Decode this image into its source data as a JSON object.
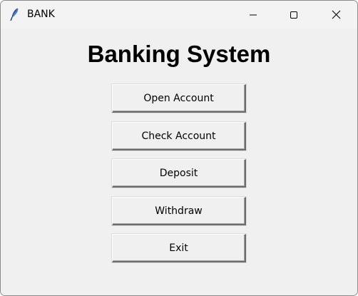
{
  "window": {
    "title": "BANK",
    "icon": "feather-icon"
  },
  "controls": {
    "minimize_icon": "minimize-icon",
    "maximize_icon": "maximize-icon",
    "close_icon": "close-icon"
  },
  "main": {
    "heading": "Banking System",
    "buttons": [
      {
        "label": "Open Account"
      },
      {
        "label": "Check Account"
      },
      {
        "label": "Deposit"
      },
      {
        "label": "Withdraw"
      },
      {
        "label": "Exit"
      }
    ]
  },
  "colors": {
    "background": "#f0f0f0",
    "titlebar": "#f3f3f3",
    "text": "#000000"
  }
}
